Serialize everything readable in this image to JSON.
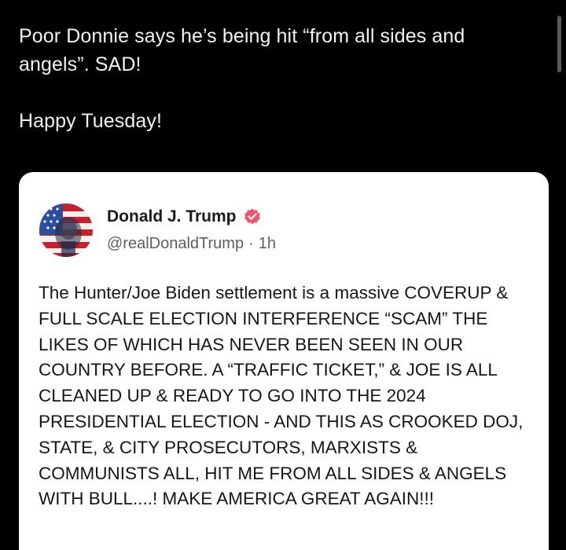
{
  "post": {
    "line1": "Poor Donnie says he’s being hit “from all sides and angels”. SAD!",
    "line2": "Happy Tuesday!"
  },
  "quoted": {
    "display_name": "Donald J. Trump",
    "handle": "@realDonaldTrump",
    "separator": "·",
    "time": "1h",
    "verified_icon": "verified-badge-icon",
    "body": "The Hunter/Joe Biden settlement is a massive COVERUP & FULL SCALE ELECTION INTERFERENCE “SCAM” THE LIKES OF WHICH HAS NEVER BEEN SEEN IN OUR COUNTRY BEFORE. A “TRAFFIC TICKET,” & JOE IS ALL CLEANED UP & READY TO GO INTO THE 2024 PRESIDENTIAL ELECTION - AND THIS AS CROOKED DOJ, STATE, & CITY PROSECUTORS, MARXISTS & COMMUNISTS ALL, HIT ME FROM ALL SIDES & ANGELS WITH BULL....! MAKE AMERICA GREAT AGAIN!!!"
  },
  "colors": {
    "background": "#000000",
    "card": "#ffffff",
    "verified_badge": "#f0566a",
    "handle_text": "#5b5f63"
  }
}
